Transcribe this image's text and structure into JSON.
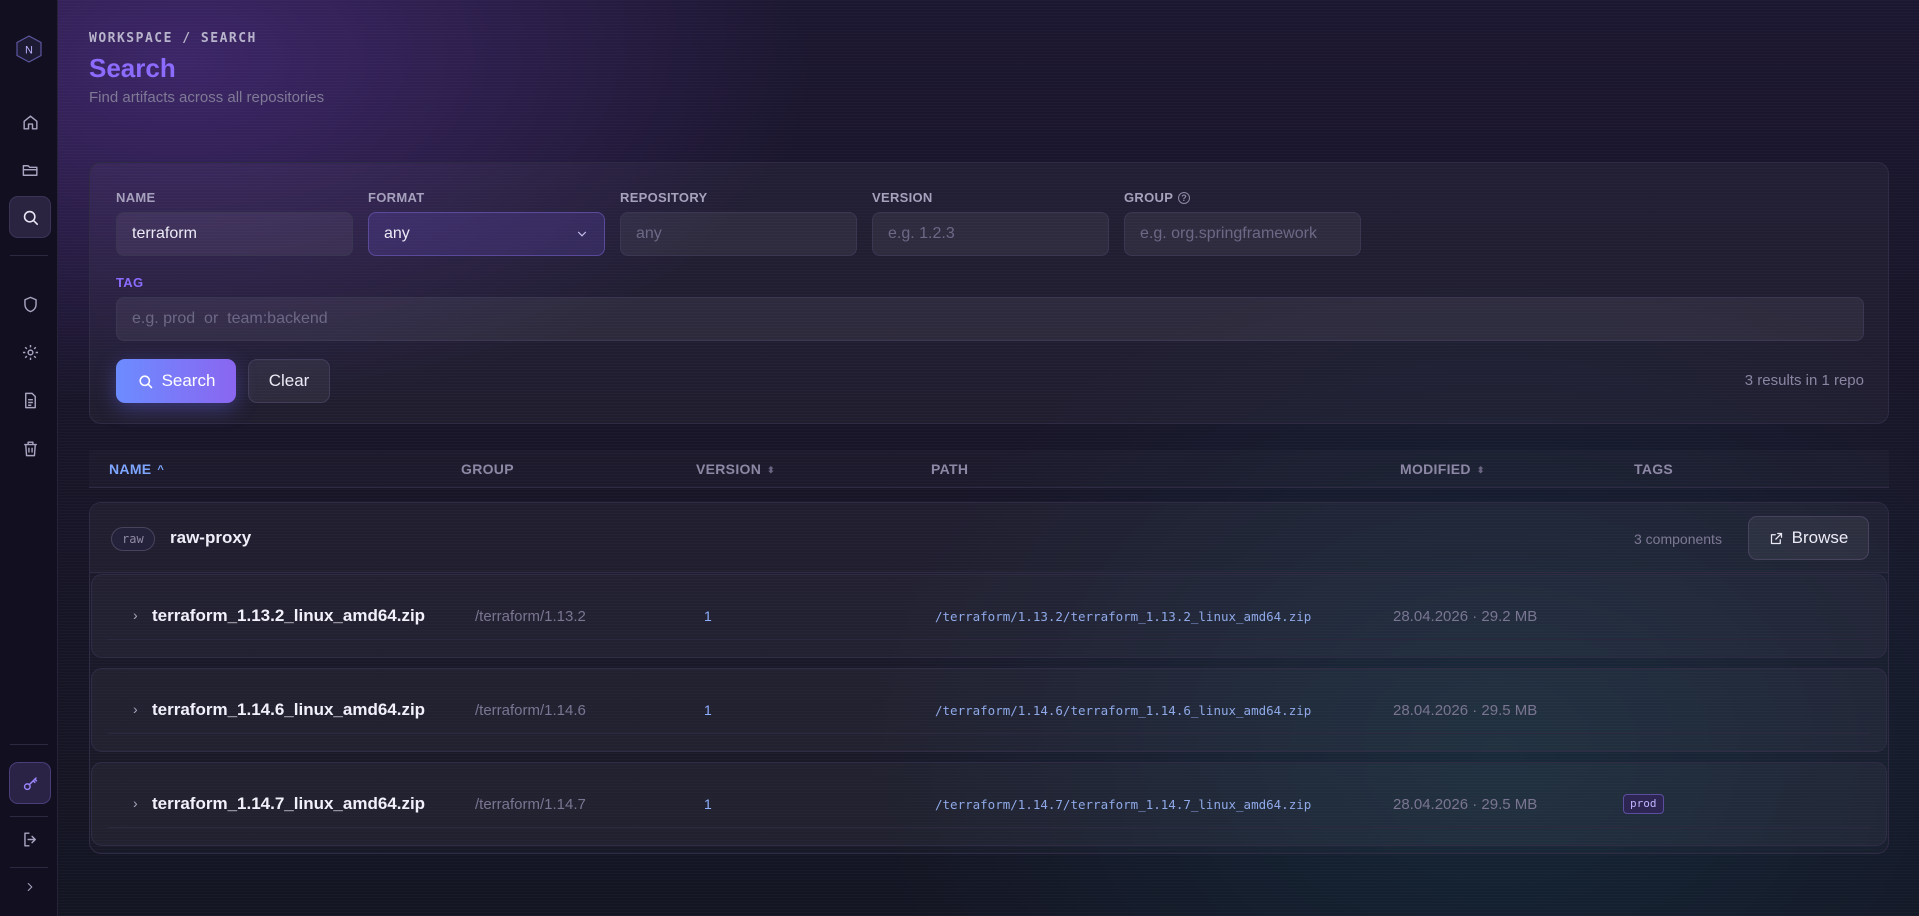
{
  "sidebar": {
    "logo_letter": "N",
    "items": [
      {
        "name": "home",
        "icon": "home-icon"
      },
      {
        "name": "repositories",
        "icon": "folder-icon"
      },
      {
        "name": "search",
        "icon": "search-icon",
        "active": true
      },
      {
        "name": "security",
        "icon": "shield-icon"
      },
      {
        "name": "settings",
        "icon": "gear-icon"
      },
      {
        "name": "docs",
        "icon": "document-icon"
      },
      {
        "name": "trash",
        "icon": "trash-icon"
      },
      {
        "name": "api-keys",
        "icon": "key-icon"
      },
      {
        "name": "logout",
        "icon": "logout-icon"
      },
      {
        "name": "expand",
        "icon": "chevron-right-icon"
      }
    ]
  },
  "header": {
    "breadcrumb": "WORKSPACE / SEARCH",
    "title": "Search",
    "subtitle": "Find artifacts across all repositories"
  },
  "filters": {
    "name_label": "NAME",
    "name_value": "terraform",
    "format_label": "FORMAT",
    "format_value": "any",
    "repository_label": "REPOSITORY",
    "repository_placeholder": "any",
    "version_label": "VERSION",
    "version_placeholder": "e.g. 1.2.3",
    "group_label": "GROUP",
    "group_placeholder": "e.g. org.springframework",
    "tag_label": "TAG",
    "tag_placeholder": "e.g. prod  or  team:backend",
    "search_label": "Search",
    "clear_label": "Clear",
    "results_summary": "3 results in 1 repo"
  },
  "table": {
    "columns": [
      "NAME",
      "GROUP",
      "VERSION",
      "PATH",
      "MODIFIED",
      "TAGS"
    ],
    "groups": [
      {
        "badge": "raw",
        "name": "raw-proxy",
        "count": "3 components",
        "browse_label": "Browse",
        "rows": [
          {
            "name": "terraform_1.13.2_linux_amd64.zip",
            "group": "/terraform/1.13.2",
            "version": "1",
            "path": "/terraform/1.13.2/terraform_1.13.2_linux_amd64.zip",
            "modified": "28.04.2026 · 29.2 MB",
            "tag": ""
          },
          {
            "name": "terraform_1.14.6_linux_amd64.zip",
            "group": "/terraform/1.14.6",
            "version": "1",
            "path": "/terraform/1.14.6/terraform_1.14.6_linux_amd64.zip",
            "modified": "28.04.2026 · 29.5 MB",
            "tag": ""
          },
          {
            "name": "terraform_1.14.7_linux_amd64.zip",
            "group": "/terraform/1.14.7",
            "version": "1",
            "path": "/terraform/1.14.7/terraform_1.14.7_linux_amd64.zip",
            "modified": "28.04.2026 · 29.5 MB",
            "tag": "prod"
          }
        ]
      }
    ]
  },
  "colors": {
    "accent": "#8c6cff",
    "link": "#8fb0ff",
    "background": "#181528"
  }
}
